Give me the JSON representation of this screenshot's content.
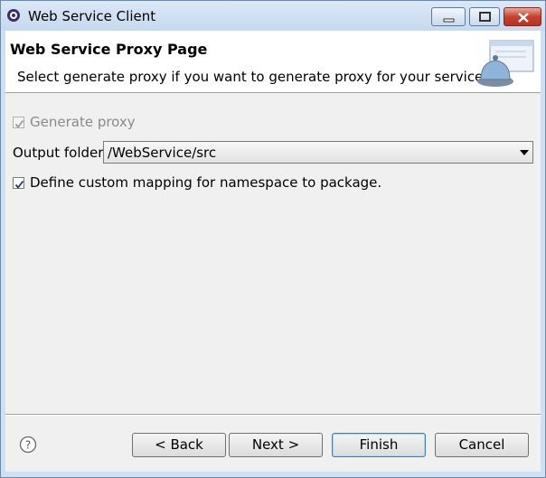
{
  "window": {
    "title": "Web Service Client"
  },
  "header": {
    "page_title": "Web Service Proxy Page",
    "description": "Select generate proxy if you want to generate proxy for your service."
  },
  "form": {
    "generate_proxy": {
      "label": "Generate proxy",
      "checked": true,
      "enabled": false
    },
    "output_folder": {
      "label": "Output folder",
      "value": "/WebService/src"
    },
    "custom_mapping": {
      "label": "Define custom mapping for namespace to package.",
      "checked": true
    }
  },
  "buttons": {
    "back": "< Back",
    "next": "Next >",
    "finish": "Finish",
    "cancel": "Cancel"
  },
  "icons": {
    "app": "eclipse-gear-icon",
    "wizard": "service-bell-icon",
    "help": "help-icon"
  }
}
